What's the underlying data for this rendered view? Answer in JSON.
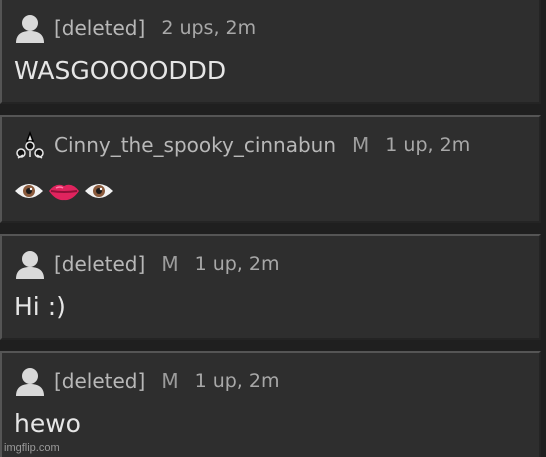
{
  "comments": [
    {
      "username": "[deleted]",
      "mod_badge": "",
      "meta": "2 ups, 2m",
      "text": "WASGOOOODDD",
      "avatar_icon": "default-user-icon"
    },
    {
      "username": "Cinny_the_spooky_cinnabun",
      "mod_badge": "M",
      "meta": "1 up, 2m",
      "text": "",
      "emojis": [
        "eye-emoji",
        "lips-emoji",
        "eye-emoji"
      ],
      "avatar_icon": "custom-avatar-icon"
    },
    {
      "username": "[deleted]",
      "mod_badge": "M",
      "meta": "1 up, 2m",
      "text": "Hi :)",
      "avatar_icon": "default-user-icon"
    },
    {
      "username": "[deleted]",
      "mod_badge": "M",
      "meta": "1 up, 2m",
      "text": "hewo",
      "avatar_icon": "default-user-icon"
    }
  ],
  "watermark": "imgflip.com",
  "colors": {
    "panel": "#2e2e2e",
    "background": "#1f1f1f",
    "text": "#e6e6e6",
    "meta": "#a8a8a8"
  }
}
